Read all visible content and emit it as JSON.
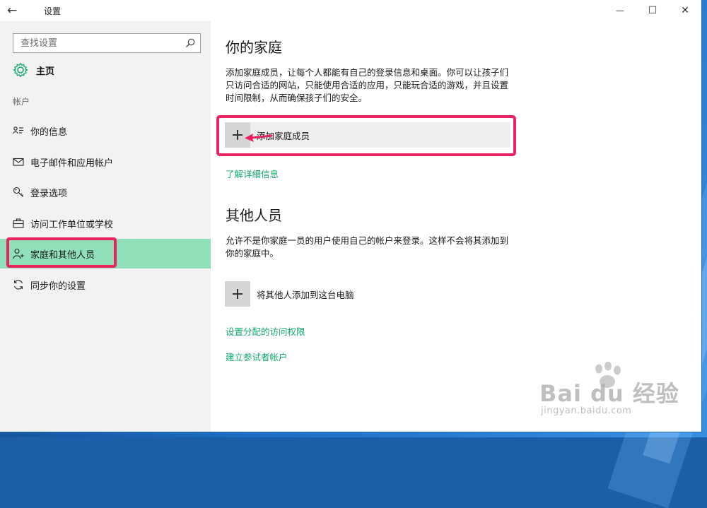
{
  "window": {
    "title": "设置"
  },
  "titlebar": {
    "back": "←",
    "minimize": "—",
    "maximize": "☐",
    "close": "✕"
  },
  "sidebar": {
    "search_placeholder": "查找设置",
    "home_label": "主页",
    "section_label": "帐户",
    "items": [
      {
        "label": "你的信息",
        "icon": "person-card-icon"
      },
      {
        "label": "电子邮件和应用帐户",
        "icon": "mail-icon"
      },
      {
        "label": "登录选项",
        "icon": "key-icon"
      },
      {
        "label": "访问工作单位或学校",
        "icon": "briefcase-icon"
      },
      {
        "label": "家庭和其他人员",
        "icon": "person-add-icon",
        "active": true
      },
      {
        "label": "同步你的设置",
        "icon": "sync-icon"
      }
    ]
  },
  "content": {
    "family": {
      "title": "你的家庭",
      "description": "添加家庭成员，让每个人都能有自己的登录信息和桌面。你可以让孩子们只访问合适的网站，只能使用合适的应用，只能玩合适的游戏，并且设置时间限制，从而确保孩子们的安全。",
      "add_label": "添加家庭成员",
      "link": "了解详细信息"
    },
    "others": {
      "title": "其他人员",
      "description": "允许不是你家庭一员的用户使用自己的帐户来登录。这样不会将其添加到你的家庭中。",
      "add_label": "将其他人添加到这台电脑",
      "link_access": "设置分配的访问权限",
      "link_kiosk": "建立参试者帐户"
    }
  },
  "watermark": {
    "main": "Bai du 经验",
    "sub": "jingyan.baidu.com"
  },
  "colors": {
    "accent_green": "#10a86a",
    "active_bg": "#8fe0b8",
    "highlight": "#e8235f"
  }
}
